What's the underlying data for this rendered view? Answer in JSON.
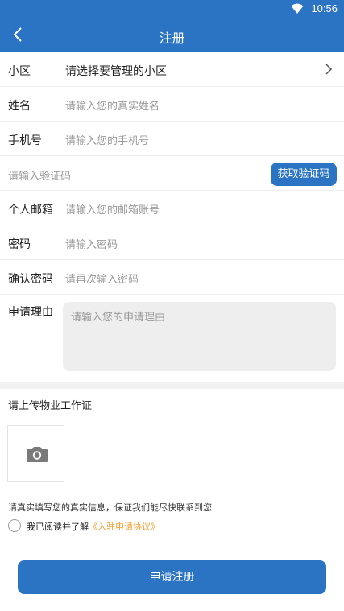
{
  "status_bar": {
    "time": "10:56",
    "icons": [
      "wifi-icon"
    ]
  },
  "header": {
    "title": "注册",
    "back_icon": "chevron-left-icon"
  },
  "form": {
    "community": {
      "label": "小区",
      "value": "请选择要管理的小区"
    },
    "name": {
      "label": "姓名",
      "placeholder": "请输入您的真实姓名"
    },
    "phone": {
      "label": "手机号",
      "placeholder": "请输入您的手机号"
    },
    "code": {
      "placeholder": "请输入验证码",
      "button": "获取验证码"
    },
    "email": {
      "label": "个人邮箱",
      "placeholder": "请输入您的邮箱账号"
    },
    "password": {
      "label": "密码",
      "placeholder": "请输入密码"
    },
    "confirm": {
      "label": "确认密码",
      "placeholder": "请再次输入密码"
    },
    "reason": {
      "label": "申请理由",
      "placeholder": "请输入您的申请理由"
    }
  },
  "upload": {
    "label": "请上传物业工作证",
    "icon": "camera-icon"
  },
  "notice": "请真实填写您的真实信息，保证我们能尽快联系到您",
  "agreement": {
    "checked": false,
    "text": "我已阅读并了解",
    "link": "《入驻申请协议》"
  },
  "submit_label": "申请注册",
  "colors": {
    "primary": "#2b74c4",
    "link": "#f0a030",
    "placeholder": "#9a9a9a",
    "input_bg": "#eeeeee"
  }
}
